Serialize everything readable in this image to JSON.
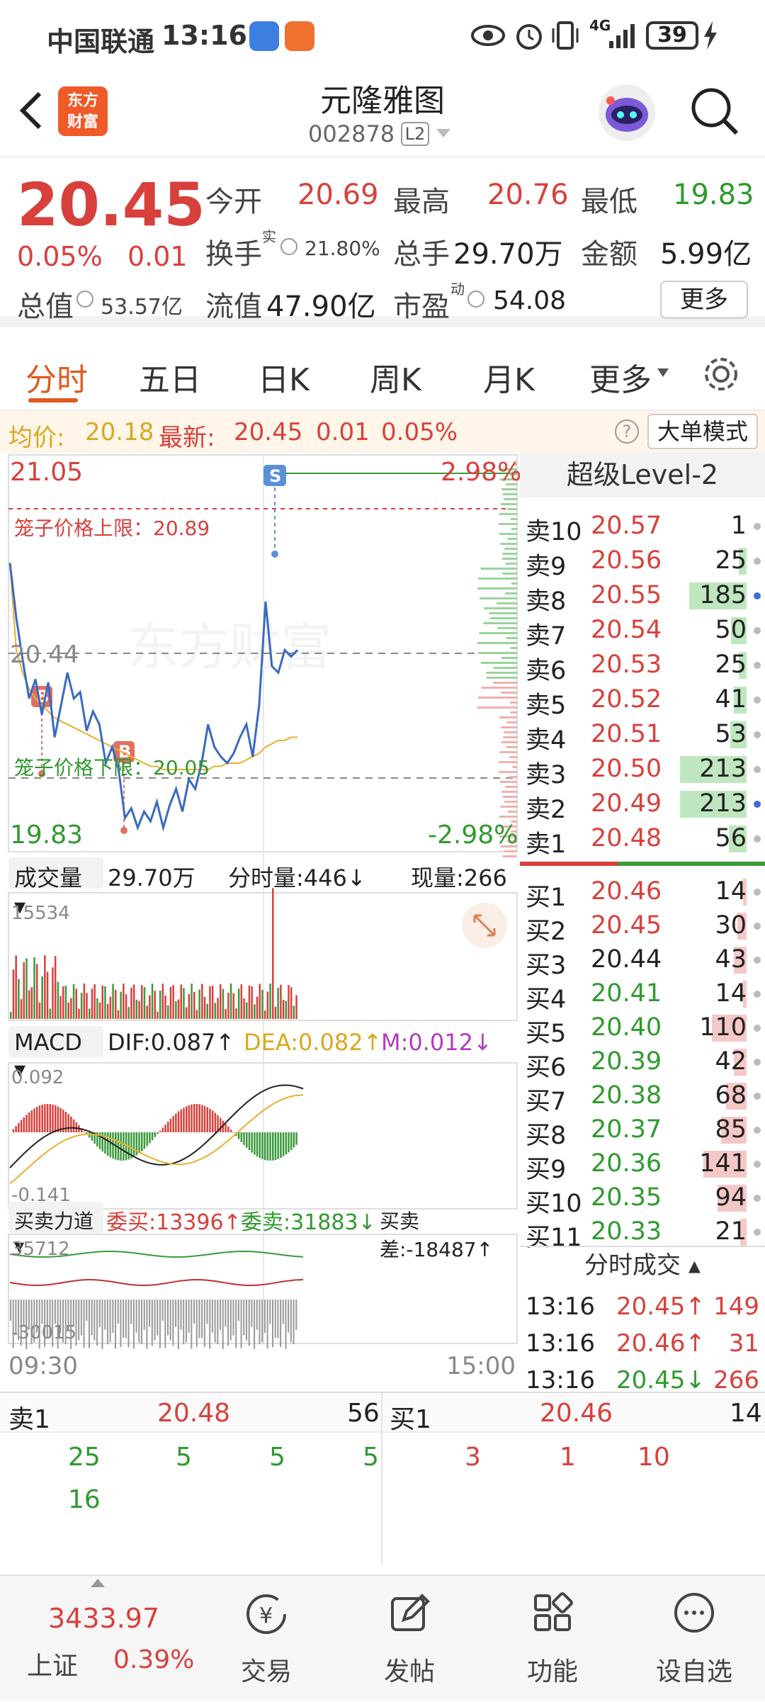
{
  "status": {
    "carrier": "中国联通",
    "time": "13:16",
    "network": "4G",
    "battery": "39"
  },
  "nav": {
    "title": "元隆雅图",
    "code": "002878",
    "level": "L2",
    "logo_line1": "东方",
    "logo_line2": "财富"
  },
  "quote": {
    "price": "20.45",
    "change_pct": "0.05%",
    "change": "0.01",
    "open_label": "今开",
    "open": "20.69",
    "high_label": "最高",
    "high": "20.76",
    "low_label": "最低",
    "low": "19.83",
    "turnover_label": "换手",
    "turnover_sup": "实",
    "turnover": "21.80%",
    "volume_label": "总手",
    "volume": "29.70万",
    "amount_label": "金额",
    "amount": "5.99亿",
    "mktcap_label": "总值",
    "mktcap": "53.57亿",
    "float_label": "流值",
    "float_cap": "47.90亿",
    "pe_label": "市盈",
    "pe_sup": "动",
    "pe": "54.08",
    "more_btn": "更多"
  },
  "tabs": [
    "分时",
    "五日",
    "日K",
    "周K",
    "月K",
    "更多"
  ],
  "infobar": {
    "avg_label": "均价:",
    "avg": "20.18",
    "last_label": "最新:",
    "last": "20.45",
    "chg": "0.01",
    "pct": "0.05%",
    "mode_btn": "大单模式"
  },
  "chart": {
    "y_max": "21.05",
    "y_max_pct": "2.98%",
    "y_min": "19.83",
    "y_min_pct": "-2.98%",
    "cage_upper": "笼子价格上限：20.89",
    "cage_lower": "笼子价格下限：20.05",
    "ref_price": "20.44",
    "watermark": "东方财富",
    "marker_s": "S",
    "marker_b": "B",
    "time_start": "09:30",
    "time_end": "15:00",
    "vol_label": "成交量",
    "vol_total": "29.70万",
    "vol_tick": "分时量:446↓",
    "vol_now": "现量:266",
    "vol_max": "15534",
    "macd_label": "MACD",
    "dif": "DIF:0.087↑",
    "dea": "DEA:0.082↑",
    "m": "M:0.012↓",
    "macd_max": "0.092",
    "macd_min": "-0.141",
    "force_label": "买卖力道",
    "weimai": "委买:13396↑",
    "weimai_sell": "委卖:31883↓",
    "diff": "买卖差:-18487↑",
    "force_max": "35712",
    "force_min": "-30015"
  },
  "chart_data": {
    "type": "line",
    "series": [
      {
        "name": "最新",
        "values": [
          20.72,
          20.55,
          20.42,
          20.3,
          20.36,
          20.25,
          20.35,
          20.18,
          20.28,
          20.38,
          20.3,
          20.32,
          20.2,
          20.26,
          20.22,
          20.1,
          20.15,
          20.08,
          19.93,
          19.96,
          19.9,
          19.95,
          19.92,
          19.98,
          19.9,
          19.97,
          20.02,
          19.95,
          20.05,
          20.02,
          20.1,
          20.22,
          20.15,
          20.12,
          20.1,
          20.13,
          20.18,
          20.22,
          20.12,
          20.28,
          20.6,
          20.4,
          20.38,
          20.45,
          20.43,
          20.45
        ]
      },
      {
        "name": "均价",
        "values": [
          20.72,
          20.45,
          20.38,
          20.33,
          20.3,
          20.28,
          20.26,
          20.24,
          20.23,
          20.22,
          20.21,
          20.2,
          20.19,
          20.18,
          20.17,
          20.16,
          20.15,
          20.14,
          20.13,
          20.12,
          20.11,
          20.1,
          20.09,
          20.09,
          20.08,
          20.08,
          20.08,
          20.08,
          20.08,
          20.08,
          20.08,
          20.08,
          20.09,
          20.09,
          20.1,
          20.1,
          20.1,
          20.11,
          20.12,
          20.13,
          20.15,
          20.16,
          20.17,
          20.17,
          20.18,
          20.18
        ]
      }
    ],
    "ylim": [
      19.83,
      21.05
    ]
  },
  "book": {
    "title": "超级Level-2",
    "asks": [
      {
        "label": "卖10",
        "price": "20.57",
        "qty": "1",
        "bar": 0.0
      },
      {
        "label": "卖9",
        "price": "20.56",
        "qty": "25",
        "bar": 0.06
      },
      {
        "label": "卖8",
        "price": "20.55",
        "qty": "185",
        "bar": 0.45
      },
      {
        "label": "卖7",
        "price": "20.54",
        "qty": "50",
        "bar": 0.12
      },
      {
        "label": "卖6",
        "price": "20.53",
        "qty": "25",
        "bar": 0.06
      },
      {
        "label": "卖5",
        "price": "20.52",
        "qty": "41",
        "bar": 0.1
      },
      {
        "label": "卖4",
        "price": "20.51",
        "qty": "53",
        "bar": 0.13
      },
      {
        "label": "卖3",
        "price": "20.50",
        "qty": "213",
        "bar": 0.52
      },
      {
        "label": "卖2",
        "price": "20.49",
        "qty": "213",
        "bar": 0.52
      },
      {
        "label": "卖1",
        "price": "20.48",
        "qty": "56",
        "bar": 0.14
      }
    ],
    "bids": [
      {
        "label": "买1",
        "price": "20.46",
        "qty": "14",
        "bar": 0.03
      },
      {
        "label": "买2",
        "price": "20.45",
        "qty": "30",
        "bar": 0.07
      },
      {
        "label": "买3",
        "price": "20.44",
        "qty": "43",
        "bar": 0.1
      },
      {
        "label": "买4",
        "price": "20.41",
        "qty": "14",
        "bar": 0.03
      },
      {
        "label": "买5",
        "price": "20.40",
        "qty": "110",
        "bar": 0.27
      },
      {
        "label": "买6",
        "price": "20.39",
        "qty": "42",
        "bar": 0.1
      },
      {
        "label": "买7",
        "price": "20.38",
        "qty": "68",
        "bar": 0.16
      },
      {
        "label": "买8",
        "price": "20.37",
        "qty": "85",
        "bar": 0.2
      },
      {
        "label": "买9",
        "price": "20.36",
        "qty": "141",
        "bar": 0.34
      },
      {
        "label": "买10",
        "price": "20.35",
        "qty": "94",
        "bar": 0.23
      },
      {
        "label": "买11",
        "price": "20.33",
        "qty": "21",
        "bar": 0.05
      }
    ],
    "trades_title": "分时成交",
    "trades": [
      {
        "time": "13:16",
        "price": "20.45↑",
        "qty": "149"
      },
      {
        "time": "13:16",
        "price": "20.46↑",
        "qty": "31"
      },
      {
        "time": "13:16",
        "price": "20.45↓",
        "qty": "266"
      }
    ]
  },
  "queue": {
    "sell_label": "卖1",
    "sell_price": "20.48",
    "sell_qty": "56",
    "buy_label": "买1",
    "buy_price": "20.46",
    "buy_qty": "14",
    "sell_items": [
      "25",
      "5",
      "5",
      "5",
      "16"
    ],
    "buy_items": [
      "3",
      "1",
      "10"
    ]
  },
  "bottom": {
    "index_value": "3433.97",
    "index_name": "上证",
    "index_pct": "0.39%",
    "trade": "交易",
    "post": "发帖",
    "func": "功能",
    "watch": "设自选"
  }
}
